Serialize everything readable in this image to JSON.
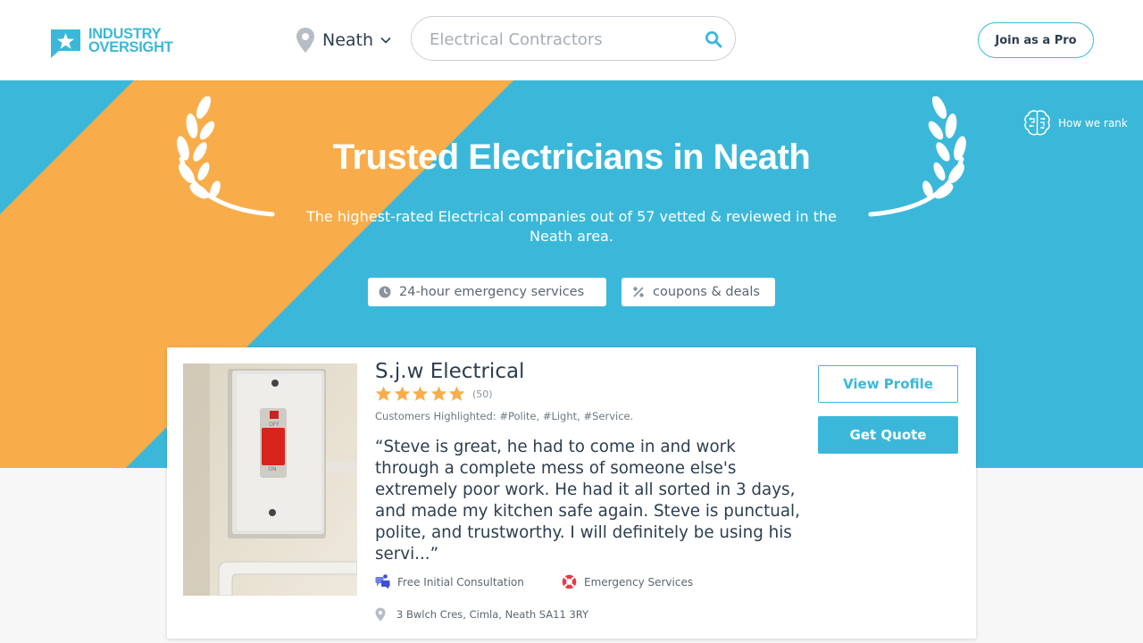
{
  "header": {
    "logo_line1": "INDUSTRY",
    "logo_line2": "OVERSIGHT",
    "location": "Neath",
    "search_placeholder": "Electrical Contractors",
    "join_label": "Join as a Pro"
  },
  "hero": {
    "title": "Trusted Electricians in Neath",
    "subtitle": "The highest-rated Electrical companies out of 57 vetted & reviewed in the Neath area.",
    "how_we_rank": "How we rank",
    "chips": [
      {
        "label": "24-hour emergency services",
        "icon": "clock-icon"
      },
      {
        "label": "coupons & deals",
        "icon": "percent-icon"
      }
    ]
  },
  "listing": {
    "name": "S.j.w Electrical",
    "rating": 5,
    "review_count": "(50)",
    "highlighted": "Customers Highlighted: #Polite, #Light, #Service.",
    "quote": "“Steve is great, he had to come in and work through a complete mess of someone else's extremely poor work. He had it all sorted in 3 days, and made my kitchen safe again. Steve is punctual, polite, and trustworthy. I will definitely be using his servi...”",
    "features": [
      {
        "label": "Free Initial Consultation",
        "icon": "consultation-icon"
      },
      {
        "label": "Emergency Services",
        "icon": "lifebuoy-icon"
      }
    ],
    "address": "3 Bwlch Cres, Cimla, Neath SA11 3RY",
    "view_profile_label": "View Profile",
    "get_quote_label": "Get Quote",
    "switch_on_label": "ON",
    "switch_off_label": "OFF"
  },
  "colors": {
    "brand_blue": "#3bb8d9",
    "accent_orange": "#f8ad4a",
    "star_orange": "#f8ad4a",
    "text_dark": "#2d3e50"
  }
}
